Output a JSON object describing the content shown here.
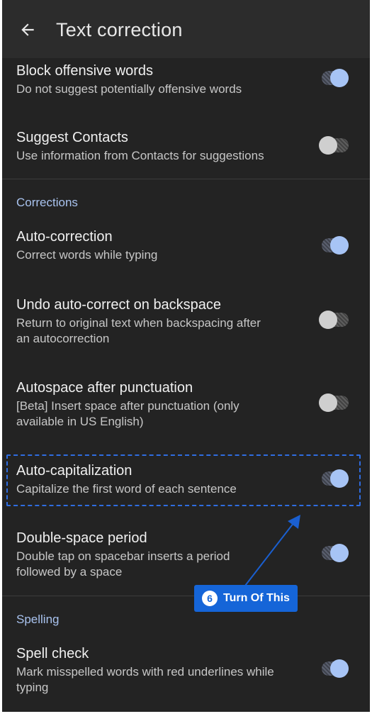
{
  "app": {
    "title": "Text correction"
  },
  "rows": {
    "block_offensive": {
      "title": "Block offensive words",
      "subtitle": "Do not suggest potentially offensive words",
      "enabled": true
    },
    "suggest_contacts": {
      "title": "Suggest Contacts",
      "subtitle": "Use information from Contacts for suggestions",
      "enabled": false
    },
    "auto_correction": {
      "title": "Auto-correction",
      "subtitle": "Correct words while typing",
      "enabled": true
    },
    "undo_autocorrect": {
      "title": "Undo auto-correct on backspace",
      "subtitle_line1": "Return to original text when backspacing after",
      "subtitle_line2": "an autocorrection",
      "enabled": false
    },
    "autospace": {
      "title": "Autospace after punctuation",
      "subtitle_line1": "[Beta] Insert space after punctuation (only",
      "subtitle_line2": "available in US English)",
      "enabled": false
    },
    "auto_capitalization": {
      "title": "Auto-capitalization",
      "subtitle": "Capitalize the first word of each sentence",
      "enabled": true
    },
    "double_space": {
      "title": "Double-space period",
      "subtitle_line1": "Double tap on spacebar inserts a period",
      "subtitle_line2": "followed by a space",
      "enabled": true
    },
    "spell_check": {
      "title": "Spell check",
      "subtitle_line1": "Mark misspelled words with red underlines while",
      "subtitle_line2": "typing",
      "enabled": true
    }
  },
  "sections": {
    "corrections": "Corrections",
    "spelling": "Spelling"
  },
  "annotation": {
    "step_number": "6",
    "text": "Turn Of This"
  },
  "colors": {
    "background": "#232323",
    "appbar": "#2c2c2c",
    "section_header": "#a9c3ef",
    "toggle_on_thumb": "#a7c4f5",
    "annotation_blue": "#1565d8"
  },
  "icons": {
    "back": "arrow-left-icon"
  }
}
